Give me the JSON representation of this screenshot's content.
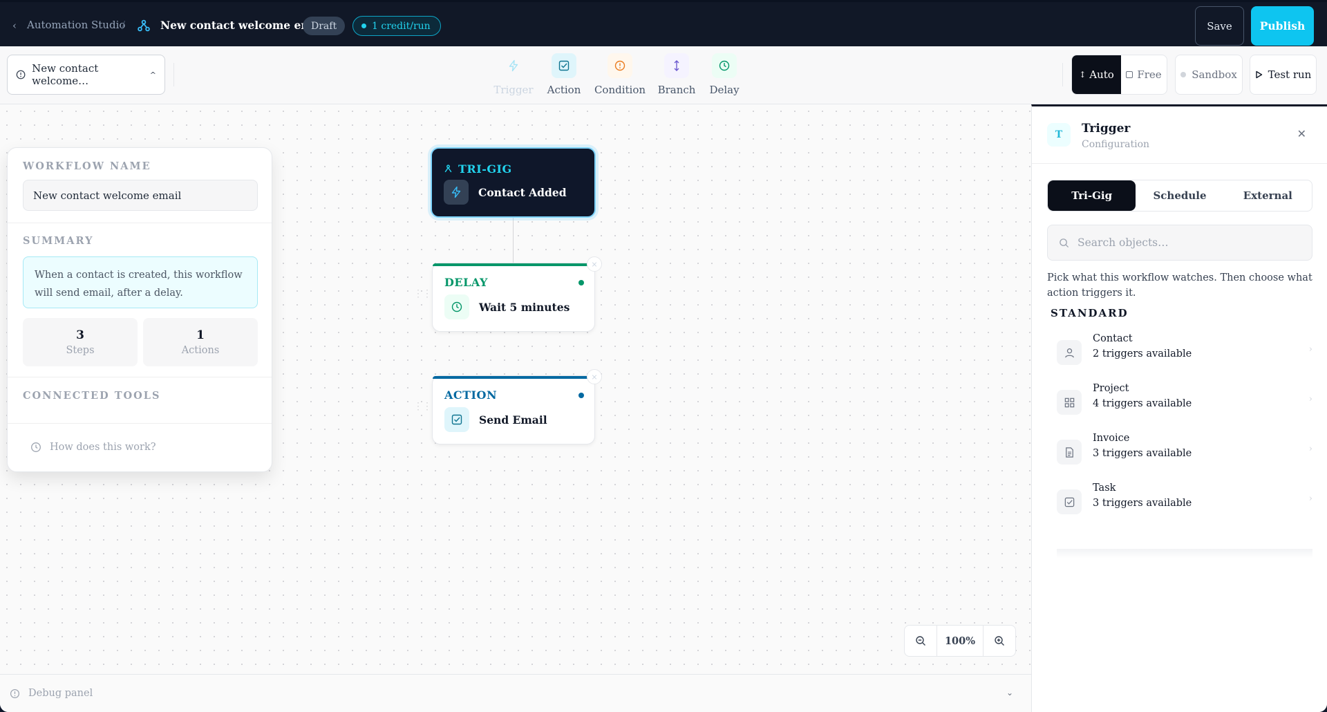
{
  "header": {
    "back_icon": "chevron-left-icon",
    "breadcrumb_root": "Automation Studio",
    "breadcrumb_sep": "/",
    "workflow_icon": "workflow-branch-icon",
    "workflow_title": "New contact welcome email",
    "status_badge": "Draft",
    "credit_badge": "1 credit/run",
    "save_label": "Save",
    "publish_label": "Publish",
    "accent_color": "#0ec5f0"
  },
  "toolbar": {
    "workflow_select": "New contact welcome…",
    "tools": [
      {
        "label": "Trigger",
        "icon": "bolt-icon",
        "disabled": true
      },
      {
        "label": "Action",
        "icon": "check-square-icon"
      },
      {
        "label": "Condition",
        "icon": "alert-circle-icon"
      },
      {
        "label": "Branch",
        "icon": "arrows-vertical-icon"
      },
      {
        "label": "Delay",
        "icon": "clock-icon"
      }
    ],
    "mode_auto": "Auto",
    "mode_free": "Free",
    "sandbox": "Sandbox",
    "test_run": "Test run"
  },
  "left_panel": {
    "workflow_name_label": "WORKFLOW NAME",
    "workflow_name_value": "New contact welcome email",
    "summary_label": "SUMMARY",
    "summary_text": "When a contact is created, this workflow will send email, after a delay.",
    "stats": [
      {
        "value": "3",
        "label": "Steps"
      },
      {
        "value": "1",
        "label": "Actions"
      }
    ],
    "connected_tools_label": "CONNECTED TOOLS",
    "help_link": "How does this work?"
  },
  "nodes": {
    "trigger": {
      "kind": "TRI-GIG",
      "name": "Contact Added",
      "color": "#22d3ee"
    },
    "delay": {
      "kind": "DELAY",
      "name": "Wait 5 minutes",
      "color": "#059669"
    },
    "action": {
      "kind": "ACTION",
      "name": "Send Email",
      "color": "#0369a1"
    },
    "close_glyph": "×"
  },
  "zoom": {
    "value": "100%"
  },
  "debug": {
    "label": "Debug panel"
  },
  "right_panel": {
    "badge": "T",
    "title": "Trigger",
    "subtitle": "Configuration",
    "tabs": [
      "Tri-Gig",
      "Schedule",
      "External"
    ],
    "active_tab": "Tri-Gig",
    "search_placeholder": "Search objects…",
    "help_text": "Pick what this workflow watches. Then choose what action triggers it.",
    "section_label": "STANDARD",
    "objects": [
      {
        "name": "Contact",
        "count": "2 triggers available",
        "icon": "user-icon"
      },
      {
        "name": "Project",
        "count": "4 triggers available",
        "icon": "grid-icon"
      },
      {
        "name": "Invoice",
        "count": "3 triggers available",
        "icon": "document-icon"
      },
      {
        "name": "Task",
        "count": "3 triggers available",
        "icon": "check-square-icon"
      }
    ]
  }
}
